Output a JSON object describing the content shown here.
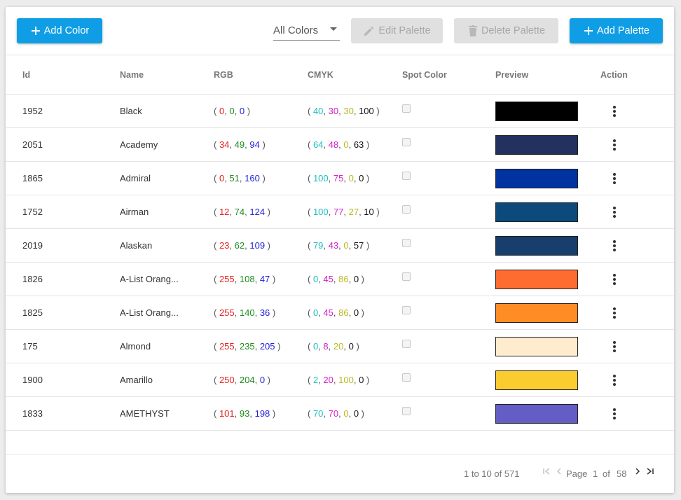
{
  "toolbar": {
    "add_color_label": "Add Color",
    "filter_value": "All Colors",
    "edit_palette_label": "Edit Palette",
    "delete_palette_label": "Delete Palette",
    "add_palette_label": "Add Palette"
  },
  "table": {
    "headers": [
      "Id",
      "Name",
      "RGB",
      "CMYK",
      "Spot Color",
      "Preview",
      "Action"
    ],
    "rows": [
      {
        "id": "1952",
        "name": "Black",
        "rgb": [
          "0",
          "0",
          "0"
        ],
        "cmyk": [
          "40",
          "30",
          "30",
          "100"
        ],
        "spot": false,
        "preview": "#000000"
      },
      {
        "id": "2051",
        "name": "Academy",
        "rgb": [
          "34",
          "49",
          "94"
        ],
        "cmyk": [
          "64",
          "48",
          "0",
          "63"
        ],
        "spot": false,
        "preview": "#22315e"
      },
      {
        "id": "1865",
        "name": "Admiral",
        "rgb": [
          "0",
          "51",
          "160"
        ],
        "cmyk": [
          "100",
          "75",
          "0",
          "0"
        ],
        "spot": false,
        "preview": "#0033a0"
      },
      {
        "id": "1752",
        "name": "Airman",
        "rgb": [
          "12",
          "74",
          "124"
        ],
        "cmyk": [
          "100",
          "77",
          "27",
          "10"
        ],
        "spot": false,
        "preview": "#0c4a7c"
      },
      {
        "id": "2019",
        "name": "Alaskan",
        "rgb": [
          "23",
          "62",
          "109"
        ],
        "cmyk": [
          "79",
          "43",
          "0",
          "57"
        ],
        "spot": false,
        "preview": "#173e6d"
      },
      {
        "id": "1826",
        "name": "A-List Orang...",
        "rgb": [
          "255",
          "108",
          "47"
        ],
        "cmyk": [
          "0",
          "45",
          "86",
          "0"
        ],
        "spot": false,
        "preview": "#ff6c2f"
      },
      {
        "id": "1825",
        "name": "A-List Orang...",
        "rgb": [
          "255",
          "140",
          "36"
        ],
        "cmyk": [
          "0",
          "45",
          "86",
          "0"
        ],
        "spot": false,
        "preview": "#ff8c24"
      },
      {
        "id": "175",
        "name": "Almond",
        "rgb": [
          "255",
          "235",
          "205"
        ],
        "cmyk": [
          "0",
          "8",
          "20",
          "0"
        ],
        "spot": false,
        "preview": "#ffebcd"
      },
      {
        "id": "1900",
        "name": "Amarillo",
        "rgb": [
          "250",
          "204",
          "0"
        ],
        "cmyk": [
          "2",
          "20",
          "100",
          "0"
        ],
        "spot": false,
        "preview": "#facc30"
      },
      {
        "id": "1833",
        "name": "AMETHYST",
        "rgb": [
          "101",
          "93",
          "198"
        ],
        "cmyk": [
          "70",
          "70",
          "0",
          "0"
        ],
        "spot": false,
        "preview": "#655dc6"
      }
    ]
  },
  "pagination": {
    "range": "1 to 10 of 571",
    "page_label": "Page",
    "current_page": "1",
    "of_label": "of",
    "total_pages": "58"
  },
  "colors": {
    "primary": "#0f9ee5",
    "disabled": "#e0e0e0"
  }
}
